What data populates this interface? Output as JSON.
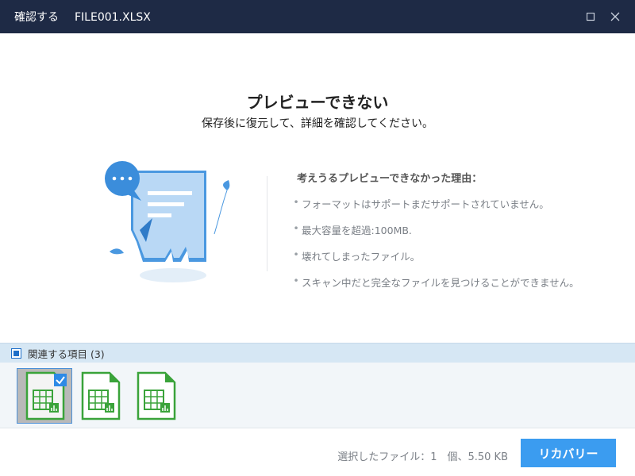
{
  "window": {
    "title_action": "確認する",
    "title_file": "FILE001.XLSX"
  },
  "message": {
    "heading": "プレビューできない",
    "subheading": "保存後に復元して、詳細を確認してください。"
  },
  "reasons": {
    "title": "考えうるプレビューできなかった理由：",
    "items": [
      "フォーマットはサポートまだサポートされていません。",
      "最大容量を超過:100MB.",
      "壊れてしまったファイル。",
      "スキャン中だと完全なファイルを見つけることができません。"
    ]
  },
  "related": {
    "label": "関連する項目 (3)"
  },
  "footer": {
    "status": "選択したファイル：1　個、5.50 KB",
    "recover_label": "リカバリー"
  },
  "colors": {
    "titlebar": "#1e2a45",
    "accent": "#3b9cf0",
    "file_green": "#3aa33a"
  }
}
